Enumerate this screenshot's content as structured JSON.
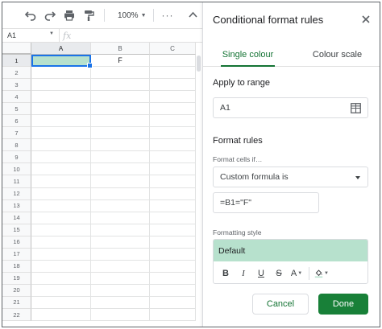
{
  "toolbar": {
    "zoom": "100%",
    "more": "···"
  },
  "formula_bar": {
    "cell_ref": "A1",
    "fx": "fx"
  },
  "columns": [
    "A",
    "B",
    "C"
  ],
  "rows": [
    {
      "num": "1",
      "a": "",
      "b": "F",
      "c": ""
    },
    {
      "num": "2",
      "a": "",
      "b": "",
      "c": ""
    },
    {
      "num": "3",
      "a": "",
      "b": "",
      "c": ""
    },
    {
      "num": "4",
      "a": "",
      "b": "",
      "c": ""
    },
    {
      "num": "5",
      "a": "",
      "b": "",
      "c": ""
    },
    {
      "num": "6",
      "a": "",
      "b": "",
      "c": ""
    },
    {
      "num": "7",
      "a": "",
      "b": "",
      "c": ""
    },
    {
      "num": "8",
      "a": "",
      "b": "",
      "c": ""
    },
    {
      "num": "9",
      "a": "",
      "b": "",
      "c": ""
    },
    {
      "num": "10",
      "a": "",
      "b": "",
      "c": ""
    },
    {
      "num": "11",
      "a": "",
      "b": "",
      "c": ""
    },
    {
      "num": "12",
      "a": "",
      "b": "",
      "c": ""
    },
    {
      "num": "13",
      "a": "",
      "b": "",
      "c": ""
    },
    {
      "num": "14",
      "a": "",
      "b": "",
      "c": ""
    },
    {
      "num": "15",
      "a": "",
      "b": "",
      "c": ""
    },
    {
      "num": "16",
      "a": "",
      "b": "",
      "c": ""
    },
    {
      "num": "17",
      "a": "",
      "b": "",
      "c": ""
    },
    {
      "num": "18",
      "a": "",
      "b": "",
      "c": ""
    },
    {
      "num": "19",
      "a": "",
      "b": "",
      "c": ""
    },
    {
      "num": "20",
      "a": "",
      "b": "",
      "c": ""
    },
    {
      "num": "21",
      "a": "",
      "b": "",
      "c": ""
    },
    {
      "num": "22",
      "a": "",
      "b": "",
      "c": ""
    }
  ],
  "panel": {
    "title": "Conditional format rules",
    "tabs": [
      "Single colour",
      "Colour scale"
    ],
    "apply_label": "Apply to range",
    "range_value": "A1",
    "format_rules_label": "Format rules",
    "format_cells_if": "Format cells if…",
    "condition": "Custom formula is",
    "formula": "=B1=\"F\"",
    "formatting_style_label": "Formatting style",
    "style_preview": "Default",
    "style_buttons": {
      "bold": "B",
      "italic": "I",
      "underline": "U",
      "strike": "S",
      "text_color": "A"
    },
    "cancel": "Cancel",
    "done": "Done"
  },
  "colors": {
    "highlight": "#b7e1cd",
    "accent_green": "#137333",
    "done_bg": "#188038",
    "selection_blue": "#1a73e8"
  }
}
